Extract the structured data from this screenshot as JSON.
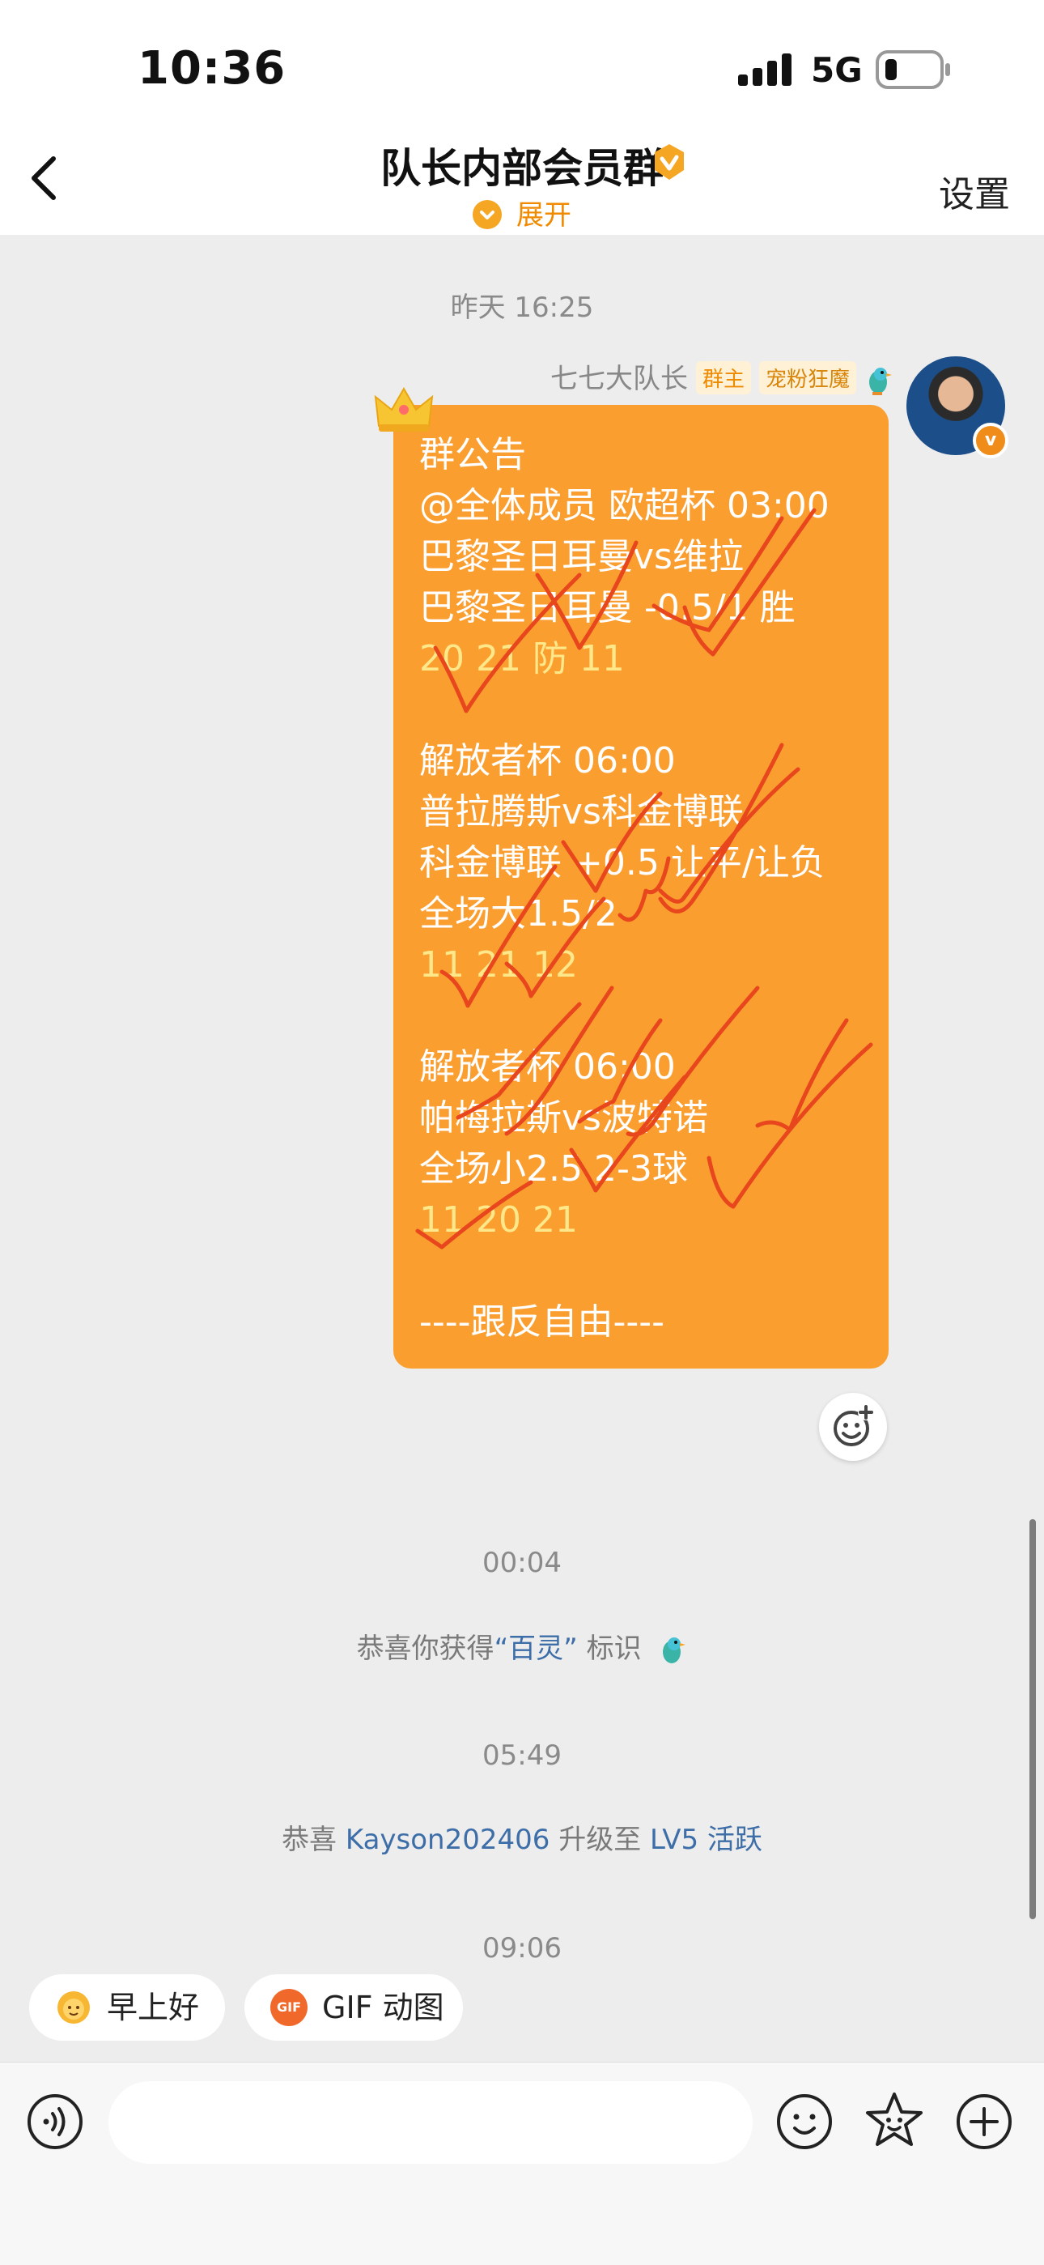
{
  "status_bar": {
    "time": "10:36",
    "network": "5G"
  },
  "header": {
    "title": "队长内部会员群",
    "expand_label": "展开",
    "settings_label": "设置"
  },
  "messages": {
    "time_1": "昨天 16:25",
    "sender": {
      "name": "七七大队长",
      "badge_owner": "群主",
      "badge_title": "宠粉狂魔"
    },
    "announcement_lines": [
      "群公告",
      "@全体成员 欧超杯 03:00",
      "巴黎圣日耳曼vs维拉",
      "巴黎圣日耳曼 -0.5/1 胜",
      "20 21 防 11",
      "",
      "解放者杯 06:00",
      "普拉腾斯vs科金博联",
      "科金博联 +0.5 让平/让负",
      "全场大1.5/2",
      "11 21 12",
      "",
      "解放者杯 06:00",
      "帕梅拉斯vs波特诺",
      "全场小2.5  2-3球",
      "11 20 21",
      "",
      "----跟反自由----"
    ],
    "time_2": "00:04",
    "system_1": {
      "prefix": "恭喜你获得",
      "name": "“百灵”",
      "suffix": " 标识"
    },
    "time_3": "05:49",
    "system_2": {
      "prefix": "恭喜 ",
      "user": "Kayson202406",
      "mid": " 升级至 ",
      "level": "LV5 活跃"
    },
    "time_4": "09:06"
  },
  "quick_replies": {
    "morning": "早上好",
    "gif": "GIF 动图",
    "gif_icon_text": "GIF"
  },
  "composer": {
    "placeholder": ""
  },
  "colors": {
    "bubble": "#fb9e30",
    "accent": "#f08a00",
    "link": "#3d6ea8",
    "check": "#e8461d"
  },
  "icons": [
    "back-icon",
    "verified-icon",
    "chevron-down-icon",
    "crown-icon",
    "bird-icon",
    "emoji-add-icon",
    "voice-icon",
    "emoji-icon",
    "star-sticker-icon",
    "plus-icon"
  ]
}
